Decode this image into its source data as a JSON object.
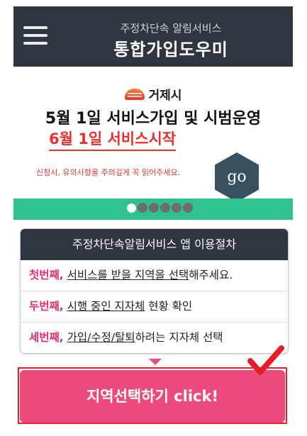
{
  "header": {
    "subtitle": "주정차단속 알림서비스",
    "title": "통합가입도우미"
  },
  "banner": {
    "logo_text": "거제시",
    "line1": "5월 1일 서비스가입 및 시범운영",
    "line2": "6월 1일 서비스시작",
    "note": "신청시, 유의사항을 주의깊게 꼭 읽어주세요.",
    "go_label": "go",
    "carousel": {
      "total": 6,
      "active_index": 0
    }
  },
  "procedure": {
    "title": "주정차단속알림서비스 앱 이용절차",
    "steps": [
      {
        "num": "첫번째,",
        "link": "서비스를 받을 지역을 선택",
        "rest": "해주세요."
      },
      {
        "num": "두번째,",
        "link": "시행 중인 지자체",
        "rest": " 현황 확인"
      },
      {
        "num": "세번째,",
        "link": "가입/수정/탈퇴",
        "rest": "하려는 지자체 선택"
      }
    ]
  },
  "cta": {
    "label": "지역선택하기 click!"
  },
  "colors": {
    "header_bg": "#2f3640",
    "accent_pink": "#e8306b",
    "cta_bg": "#ec4a7a",
    "banner_green": "#2ec38d",
    "alert_red": "#e31e26"
  },
  "icons": [
    "hamburger-menu-icon",
    "geoje-city-logo-icon",
    "checkmark-icon"
  ]
}
